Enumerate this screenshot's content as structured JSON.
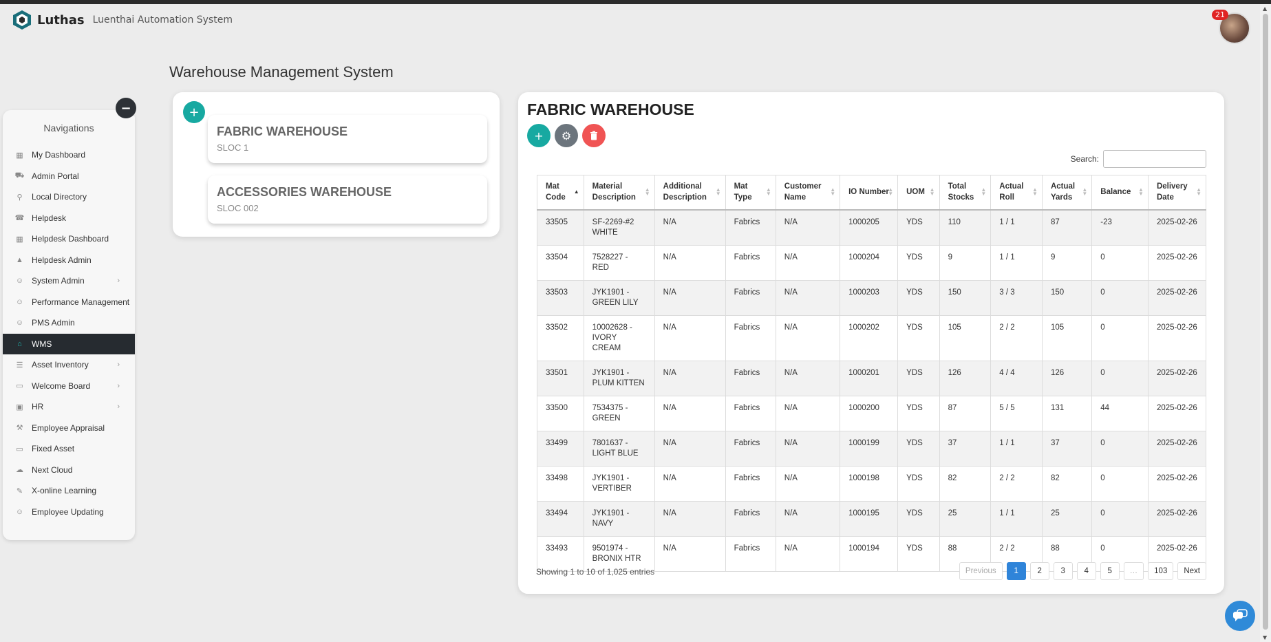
{
  "app": {
    "name": "Luthas",
    "subtitle": "Luenthai Automation System",
    "notification_count": "21"
  },
  "sidebar": {
    "title": "Navigations",
    "items": [
      {
        "label": "My Dashboard",
        "icon": "grid-icon",
        "glyph": "▦",
        "chevron": false,
        "active": false
      },
      {
        "label": "Admin Portal",
        "icon": "car-icon",
        "glyph": "⛟",
        "chevron": false,
        "active": false
      },
      {
        "label": "Local Directory",
        "icon": "map-pin-icon",
        "glyph": "⚲",
        "chevron": false,
        "active": false
      },
      {
        "label": "Helpdesk",
        "icon": "phone-icon",
        "glyph": "☎",
        "chevron": false,
        "active": false
      },
      {
        "label": "Helpdesk Dashboard",
        "icon": "table-icon",
        "glyph": "▦",
        "chevron": false,
        "active": false
      },
      {
        "label": "Helpdesk Admin",
        "icon": "warning-icon",
        "glyph": "▲",
        "chevron": false,
        "active": false
      },
      {
        "label": "System Admin",
        "icon": "user-cog-icon",
        "glyph": "☺",
        "chevron": true,
        "active": false
      },
      {
        "label": "Performance Management",
        "icon": "user-icon",
        "glyph": "☺",
        "chevron": false,
        "active": false
      },
      {
        "label": "PMS Admin",
        "icon": "user-icon",
        "glyph": "☺",
        "chevron": false,
        "active": false
      },
      {
        "label": "WMS",
        "icon": "warehouse-icon",
        "glyph": "⌂",
        "chevron": false,
        "active": true
      },
      {
        "label": "Asset Inventory",
        "icon": "list-icon",
        "glyph": "☰",
        "chevron": true,
        "active": false
      },
      {
        "label": "Welcome Board",
        "icon": "monitor-icon",
        "glyph": "▭",
        "chevron": true,
        "active": false
      },
      {
        "label": "HR",
        "icon": "id-card-icon",
        "glyph": "▣",
        "chevron": true,
        "active": false
      },
      {
        "label": "Employee Appraisal",
        "icon": "gavel-icon",
        "glyph": "⚒",
        "chevron": false,
        "active": false
      },
      {
        "label": "Fixed Asset",
        "icon": "laptop-icon",
        "glyph": "▭",
        "chevron": false,
        "active": false
      },
      {
        "label": "Next Cloud",
        "icon": "cloud-icon",
        "glyph": "☁",
        "chevron": false,
        "active": false
      },
      {
        "label": "X-online Learning",
        "icon": "learning-icon",
        "glyph": "✎",
        "chevron": false,
        "active": false
      },
      {
        "label": "Employee Updating",
        "icon": "user-edit-icon",
        "glyph": "☺",
        "chevron": false,
        "active": false
      }
    ]
  },
  "page_title": "Warehouse Management System",
  "warehouses": [
    {
      "name": "FABRIC WAREHOUSE",
      "sloc": "SLOC 1"
    },
    {
      "name": "ACCESSORIES WAREHOUSE",
      "sloc": "SLOC 002"
    }
  ],
  "main": {
    "title": "FABRIC WAREHOUSE",
    "search_label": "Search:",
    "columns": [
      "Mat Code",
      "Material Description",
      "Additional Description",
      "Mat Type",
      "Customer Name",
      "IO Number",
      "UOM",
      "Total Stocks",
      "Actual Roll",
      "Actual Yards",
      "Balance",
      "Delivery Date"
    ],
    "rows": [
      [
        "33505",
        "SF-2269-#2 WHITE",
        "N/A",
        "Fabrics",
        "N/A",
        "1000205",
        "YDS",
        "110",
        "1 / 1",
        "87",
        "-23",
        "2025-02-26"
      ],
      [
        "33504",
        "7528227 - RED",
        "N/A",
        "Fabrics",
        "N/A",
        "1000204",
        "YDS",
        "9",
        "1 / 1",
        "9",
        "0",
        "2025-02-26"
      ],
      [
        "33503",
        "JYK1901 - GREEN LILY",
        "N/A",
        "Fabrics",
        "N/A",
        "1000203",
        "YDS",
        "150",
        "3 / 3",
        "150",
        "0",
        "2025-02-26"
      ],
      [
        "33502",
        "10002628 - IVORY CREAM",
        "N/A",
        "Fabrics",
        "N/A",
        "1000202",
        "YDS",
        "105",
        "2 / 2",
        "105",
        "0",
        "2025-02-26"
      ],
      [
        "33501",
        "JYK1901 - PLUM KITTEN",
        "N/A",
        "Fabrics",
        "N/A",
        "1000201",
        "YDS",
        "126",
        "4 / 4",
        "126",
        "0",
        "2025-02-26"
      ],
      [
        "33500",
        "7534375 - GREEN",
        "N/A",
        "Fabrics",
        "N/A",
        "1000200",
        "YDS",
        "87",
        "5 / 5",
        "131",
        "44",
        "2025-02-26"
      ],
      [
        "33499",
        "7801637 - LIGHT BLUE",
        "N/A",
        "Fabrics",
        "N/A",
        "1000199",
        "YDS",
        "37",
        "1 / 1",
        "37",
        "0",
        "2025-02-26"
      ],
      [
        "33498",
        "JYK1901 - VERTIBER",
        "N/A",
        "Fabrics",
        "N/A",
        "1000198",
        "YDS",
        "82",
        "2 / 2",
        "82",
        "0",
        "2025-02-26"
      ],
      [
        "33494",
        "JYK1901 - NAVY",
        "N/A",
        "Fabrics",
        "N/A",
        "1000195",
        "YDS",
        "25",
        "1 / 1",
        "25",
        "0",
        "2025-02-26"
      ],
      [
        "33493",
        "9501974 - BRONIX HTR",
        "N/A",
        "Fabrics",
        "N/A",
        "1000194",
        "YDS",
        "88",
        "2 / 2",
        "88",
        "0",
        "2025-02-26"
      ]
    ],
    "info": "Showing 1 to 10 of 1,025 entries",
    "pagination": [
      "Previous",
      "1",
      "2",
      "3",
      "4",
      "5",
      "…",
      "103",
      "Next"
    ],
    "active_page": "1"
  },
  "colors": {
    "accent_teal": "#17a9a1",
    "gear_gray": "#6c757d",
    "delete_red": "#f05454",
    "active_page_blue": "#2f84d9",
    "nav_active_bg": "#262b30"
  }
}
